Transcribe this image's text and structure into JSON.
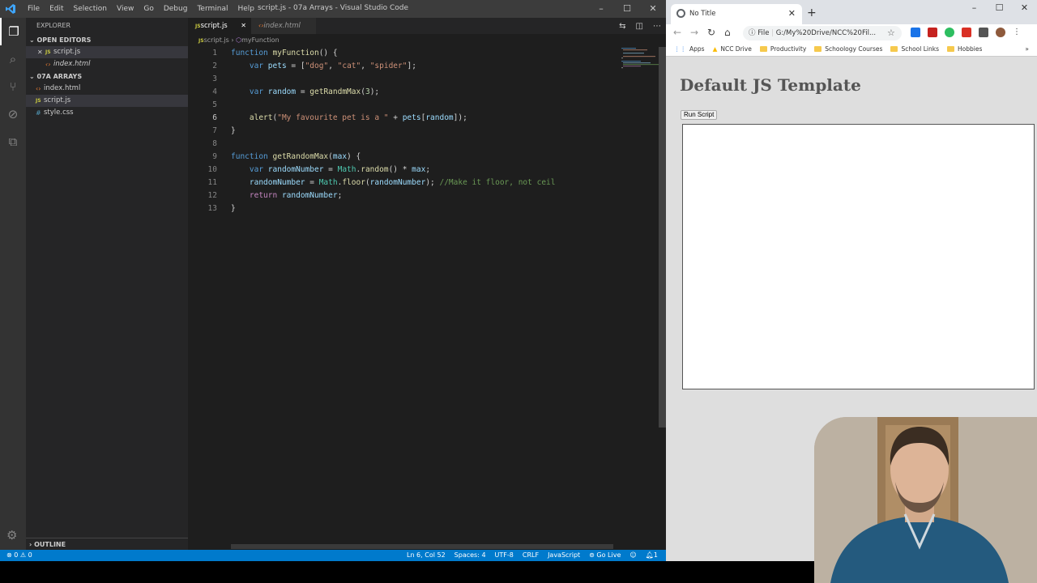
{
  "vscode": {
    "menu": [
      "File",
      "Edit",
      "Selection",
      "View",
      "Go",
      "Debug",
      "Terminal",
      "Help"
    ],
    "window_title": "script.js - 07a Arrays - Visual Studio Code",
    "explorer_label": "EXPLORER",
    "open_editors_label": "OPEN EDITORS",
    "open_editors": [
      {
        "name": "script.js",
        "type": "js"
      },
      {
        "name": "index.html",
        "type": "html"
      }
    ],
    "folder_label": "07A ARRAYS",
    "files": [
      {
        "name": "index.html",
        "type": "html"
      },
      {
        "name": "script.js",
        "type": "js"
      },
      {
        "name": "style.css",
        "type": "css"
      }
    ],
    "outline_label": "OUTLINE",
    "tabs": [
      {
        "label": "script.js"
      },
      {
        "label": "index.html"
      }
    ],
    "breadcrumb": {
      "file": "script.js",
      "symbol": "myFunction"
    },
    "line_numbers": [
      "1",
      "2",
      "3",
      "4",
      "5",
      "6",
      "7",
      "8",
      "9",
      "10",
      "11",
      "12",
      "13"
    ],
    "current_line": 6,
    "status": {
      "errors": "0",
      "warnings": "0",
      "position": "Ln 6, Col 52",
      "spaces": "Spaces: 4",
      "encoding": "UTF-8",
      "eol": "CRLF",
      "language": "JavaScript",
      "golive": "Go Live",
      "notifications": "1"
    }
  },
  "browser": {
    "tab_title": "No Title",
    "url_scheme": "File",
    "url": "G:/My%20Drive/NCC%20Fil...",
    "bookmarks": [
      "Apps",
      "NCC Drive",
      "Productivity",
      "Schoology Courses",
      "School Links",
      "Hobbies"
    ],
    "page_title": "Default JS Template",
    "run_button": "Run Script"
  }
}
